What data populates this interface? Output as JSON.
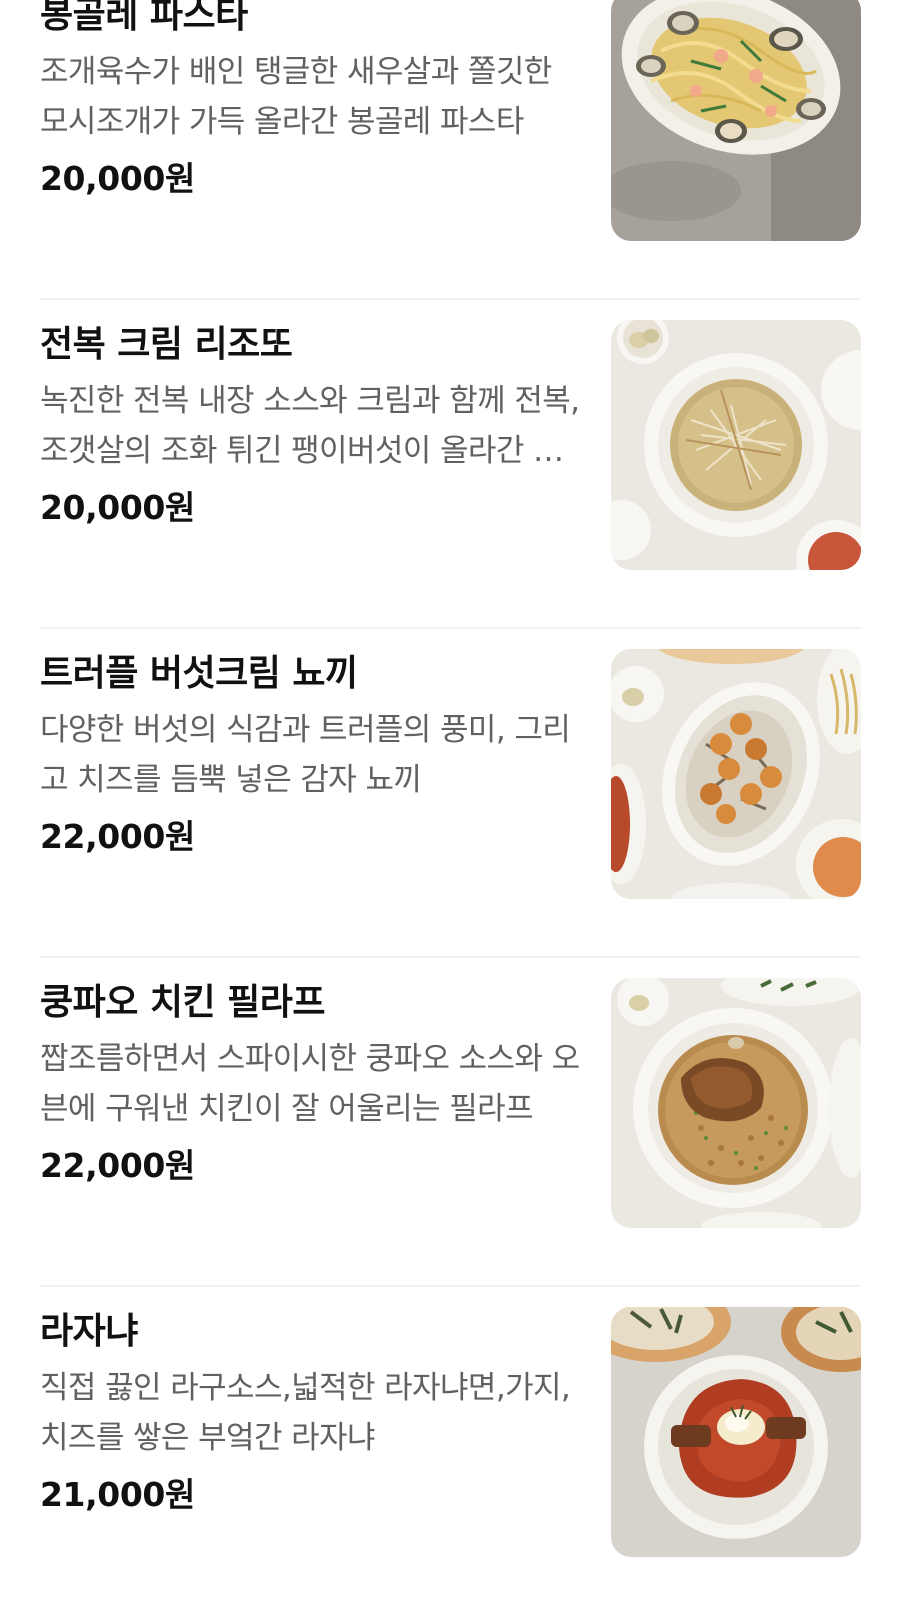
{
  "menu": {
    "items": [
      {
        "name": "봉골레 파스타",
        "description": "조개육수가 배인 탱글한 새우살과 쫄깃한 모시조개가 가득 올라간 봉골레 파스타",
        "price": "20,000원",
        "photo_icon": "vongole-pasta-photo"
      },
      {
        "name": "전복 크림 리조또",
        "description": "녹진한 전복 내장 소스와 크림과 함께 전복,조갯살의 조화 튀긴 팽이버섯이 올라간 리조또",
        "price": "20,000원",
        "photo_icon": "abalone-risotto-photo"
      },
      {
        "name": "트러플 버섯크림 뇨끼",
        "description": "다양한 버섯의 식감과 트러플의 풍미, 그리고 치즈를 듬뿍 넣은 감자 뇨끼",
        "price": "22,000원",
        "photo_icon": "truffle-gnocchi-photo"
      },
      {
        "name": "쿵파오 치킨 필라프",
        "description": "짭조름하면서 스파이시한 쿵파오 소스와 오븐에 구워낸 치킨이 잘 어울리는 필라프",
        "price": "22,000원",
        "photo_icon": "kungpao-pilaf-photo"
      },
      {
        "name": "라자냐",
        "description": "직접 끓인 라구소스,넓적한 라자냐면,가지,치즈를 쌓은 부엌간 라자냐",
        "price": "21,000원",
        "photo_icon": "lasagna-photo"
      }
    ]
  },
  "colors": {
    "name_text": "#111111",
    "description_text": "#616161",
    "price_text": "#111111",
    "divider": "#f1f1f3"
  }
}
